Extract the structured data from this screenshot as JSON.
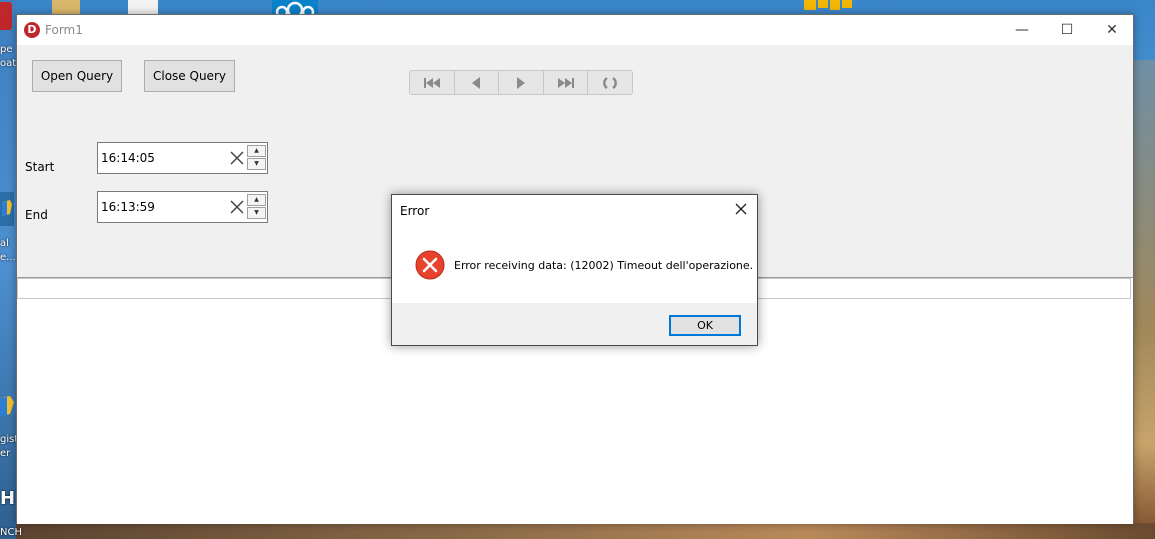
{
  "desktop": {
    "left_labels": [
      "pe",
      "oat",
      "al",
      "e...",
      "gist",
      "er",
      "H",
      "NCH"
    ]
  },
  "window": {
    "title": "Form1",
    "app_icon_letter": "D",
    "minimize_glyph": "—",
    "maximize_glyph": "☐",
    "close_glyph": "✕"
  },
  "toolbar": {
    "open_query_label": "Open Query",
    "close_query_label": "Close Query"
  },
  "navigator": {
    "buttons": [
      "first-record",
      "prior-record",
      "next-record",
      "last-record",
      "refresh"
    ]
  },
  "fields": {
    "start_label": "Start",
    "start_value": "16:14:05",
    "end_label": "End",
    "end_value": "16:13:59"
  },
  "dialog": {
    "title": "Error",
    "message": "Error receiving data: (12002) Timeout dell'operazione.",
    "ok_label": "OK",
    "icon": "error-icon"
  },
  "colors": {
    "error_red": "#e8412c",
    "focus_blue": "#0078d7",
    "app_icon": "#c0272d"
  }
}
